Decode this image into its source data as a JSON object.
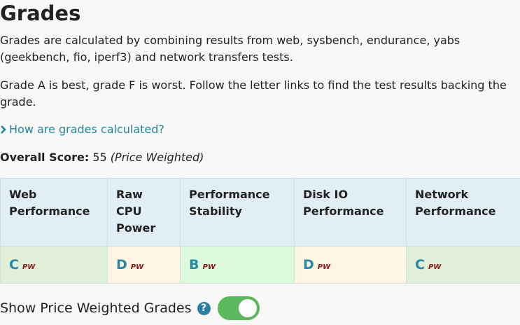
{
  "page": {
    "title": "Grades",
    "intro": "Grades are calculated by combining results from web, sysbench, endurance, yabs (geekbench, fio, iperf3) and network transfers tests.",
    "note": "Grade A is best, grade F is worst. Follow the letter links to find the test results backing the grade.",
    "how_link": "How are grades calculated?",
    "overall": {
      "label": "Overall Score:",
      "value": "55",
      "qualifier": "(Price Weighted)"
    }
  },
  "grades_table": {
    "headers": [
      "Web Performance",
      "Raw CPU Power",
      "Performance Stability",
      "Disk IO Performance",
      "Network Performance"
    ],
    "cells": [
      {
        "grade": "C",
        "tag": "PW",
        "color": "#e0efd8"
      },
      {
        "grade": "D",
        "tag": "PW",
        "color": "#fdf5e2"
      },
      {
        "grade": "B",
        "tag": "PW",
        "color": "#dcfbdd"
      },
      {
        "grade": "D",
        "tag": "PW",
        "color": "#fdf5e2"
      },
      {
        "grade": "C",
        "tag": "PW",
        "color": "#e0efd8"
      }
    ]
  },
  "toggle": {
    "label": "Show Price Weighted Grades",
    "help_icon": "?",
    "enabled": true,
    "on_color": "#5cb85c"
  },
  "colors": {
    "link": "#23849a",
    "header_bg": "#e1eef6",
    "pw_tag": "#8a1a1a"
  }
}
